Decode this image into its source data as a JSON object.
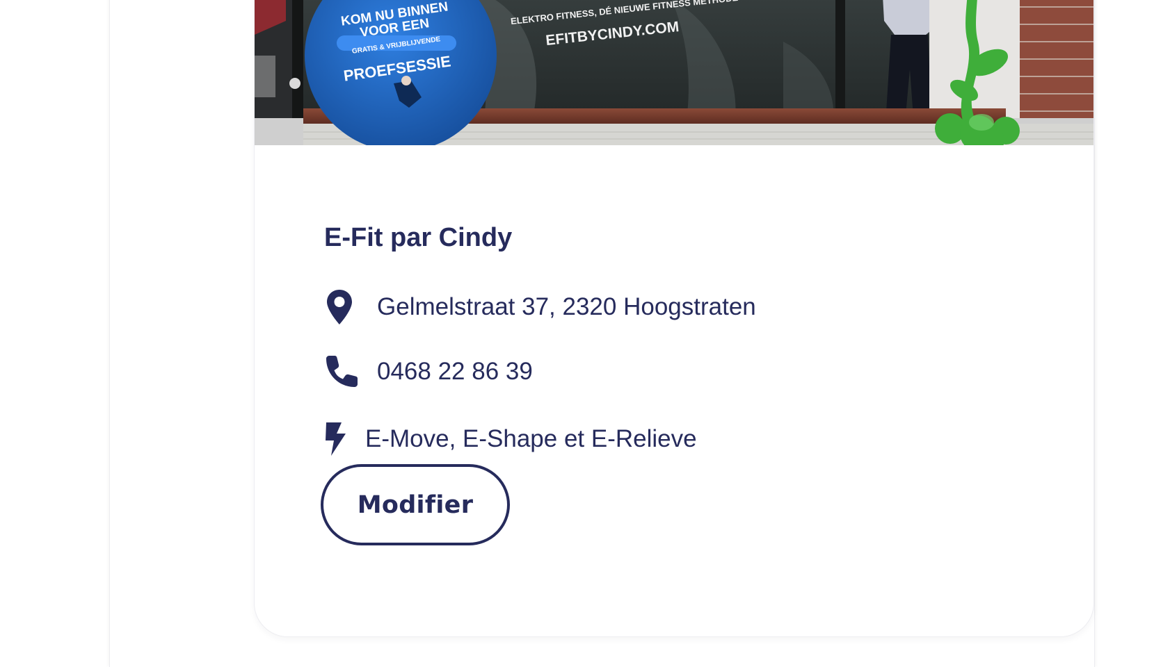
{
  "card": {
    "photo": {
      "window_sign_lines": [
        "KOM NU BINNEN",
        "VOOR EEN",
        "GRATIS & VRIJBLIJVENDE",
        "PROEFSESSIE"
      ],
      "window_tagline": "ELEKTRO FITNESS, DÉ NIEUWE FITNESS METHODE",
      "window_website": "EFITBYCINDY.COM"
    },
    "name": "E-Fit par Cindy",
    "address": {
      "icon": "map-pin-icon",
      "text": "Gelmelstraat 37, 2320 Hoogstraten"
    },
    "phone": {
      "icon": "phone-icon",
      "text": "0468 22 86 39"
    },
    "programs": {
      "icon": "lightning-bolt-icon",
      "text": "E-Move, E-Shape et E-Relieve"
    },
    "edit_button_label": "Modifier"
  },
  "colors": {
    "navy_text": "#262b5c",
    "background": "#ffffff",
    "sign_blue": "#1c5fb8"
  }
}
